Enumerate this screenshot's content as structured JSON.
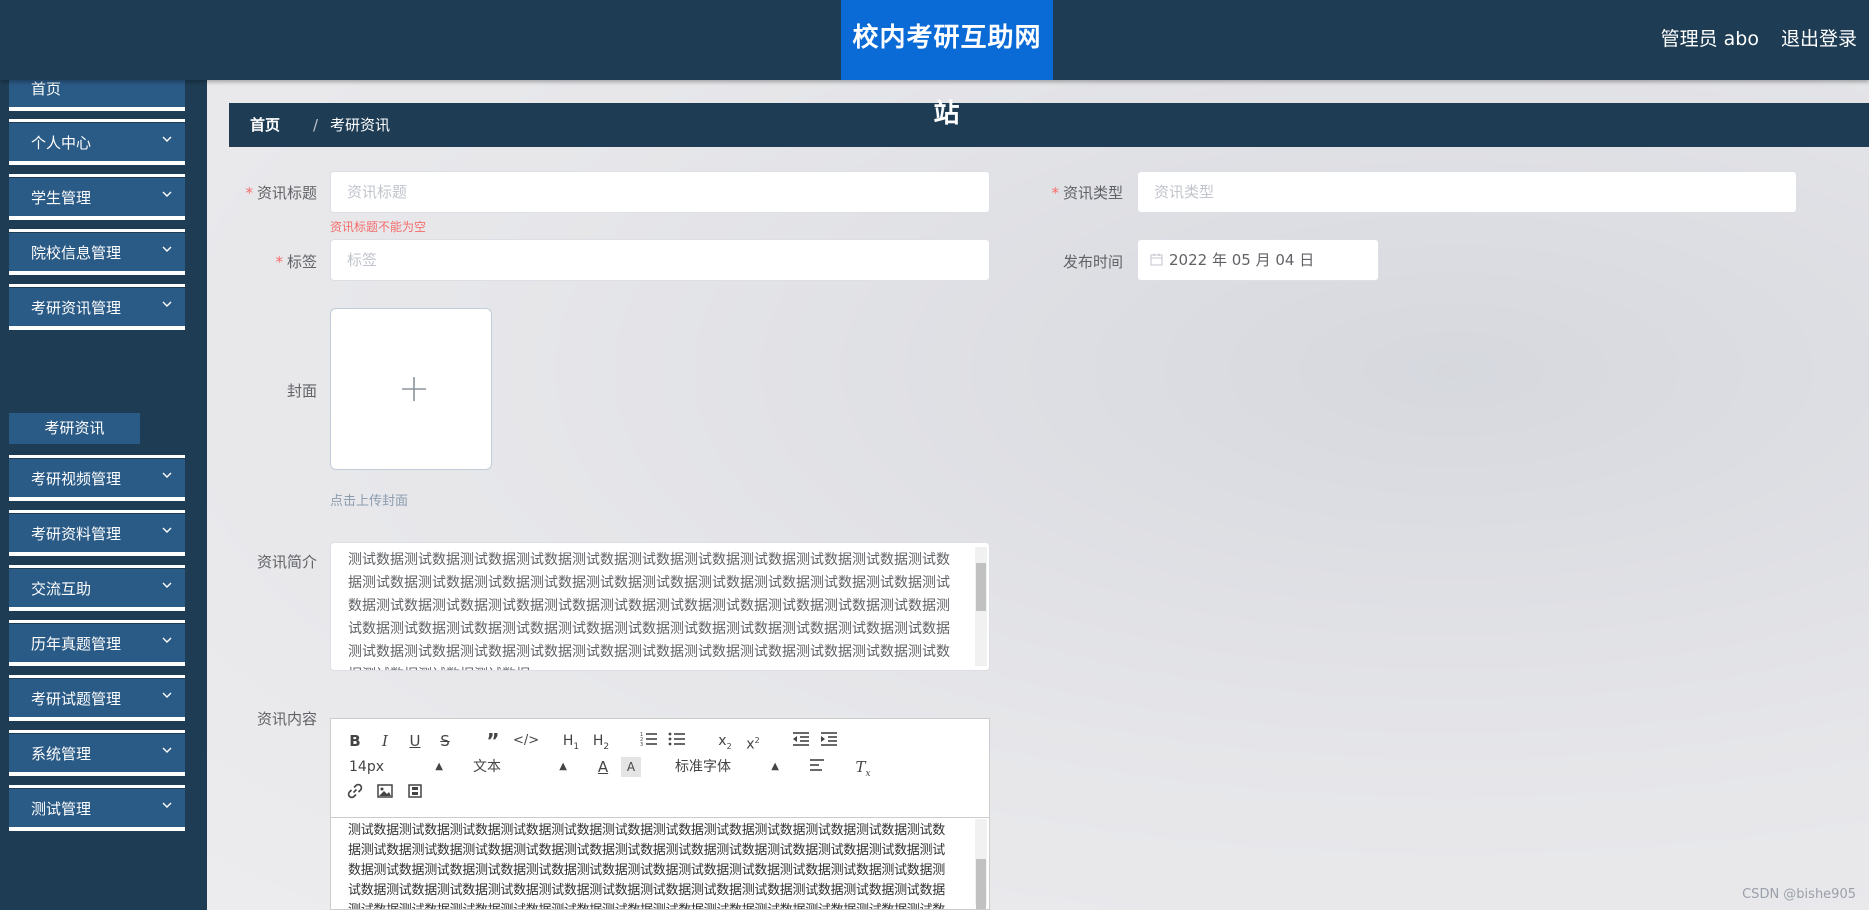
{
  "header": {
    "title": "校内考研互助网站",
    "admin_label": "管理员 abo",
    "logout_label": "退出登录"
  },
  "sidebar": {
    "items": [
      {
        "label": "首页"
      },
      {
        "label": "个人中心"
      },
      {
        "label": "学生管理"
      },
      {
        "label": "院校信息管理"
      },
      {
        "label": "考研资讯管理"
      },
      {
        "label": "考研视频管理"
      },
      {
        "label": "考研资料管理"
      },
      {
        "label": "交流互助"
      },
      {
        "label": "历年真题管理"
      },
      {
        "label": "考研试题管理"
      },
      {
        "label": "系统管理"
      },
      {
        "label": "测试管理"
      }
    ],
    "submenu_active": "考研资讯"
  },
  "breadcrumb": {
    "home": "首页",
    "separator": "/",
    "current": "考研资讯"
  },
  "form": {
    "title_label": "资讯标题",
    "title_placeholder": "资讯标题",
    "title_error": "资讯标题不能为空",
    "type_label": "资讯类型",
    "type_placeholder": "资讯类型",
    "tag_label": "标签",
    "tag_placeholder": "标签",
    "date_label": "发布时间",
    "date_value": "2022 年 05 月 04 日",
    "cover_label": "封面",
    "cover_hint": "点击上传封面",
    "intro_label": "资讯简介",
    "intro_text": "测试数据测试数据测试数据测试数据测试数据测试数据测试数据测试数据测试数据测试数据测试数据测试数据测试数据测试数据测试数据测试数据测试数据测试数据测试数据测试数据测试数据测试数据测试数据测试数据测试数据测试数据测试数据测试数据测试数据测试数据测试数据测试数据测试数据测试数据测试数据测试数据测试数据测试数据测试数据测试数据测试数据测试数据测试数据测试数据测试数据测试数据测试数据测试数据测试数据测试数据测试数据测试数据测试数据测试数据测试数据测试数据测试数据",
    "content_label": "资讯内容",
    "content_text": "测试数据测试数据测试数据测试数据测试数据测试数据测试数据测试数据测试数据测试数据测试数据测试数据测试数据测试数据测试数据测试数据测试数据测试数据测试数据测试数据测试数据测试数据测试数据测试数据测试数据测试数据测试数据测试数据测试数据测试数据测试数据测试数据测试数据测试数据测试数据测试数据测试数据测试数据测试数据测试数据测试数据测试数据测试数据测试数据测试数据测试数据测试数据测试数据测试数据测试数据测试数据测试数据测试数据测试数据测试数据测试数据测试数据测试数据测试数据测试数据测试数据测试数据测试数据测试数据测试数据测试数据测试数据测试数据测试数据测试数据"
  },
  "editor": {
    "font_size": "14px",
    "block_type": "文本",
    "font_family": "标准字体"
  },
  "watermark": "CSDN @bishe905",
  "colors": {
    "header_bg": "#1e3d54",
    "title_bg": "#0a6ad6",
    "menu_bg": "#2a5a86",
    "required": "#f56c6c"
  }
}
